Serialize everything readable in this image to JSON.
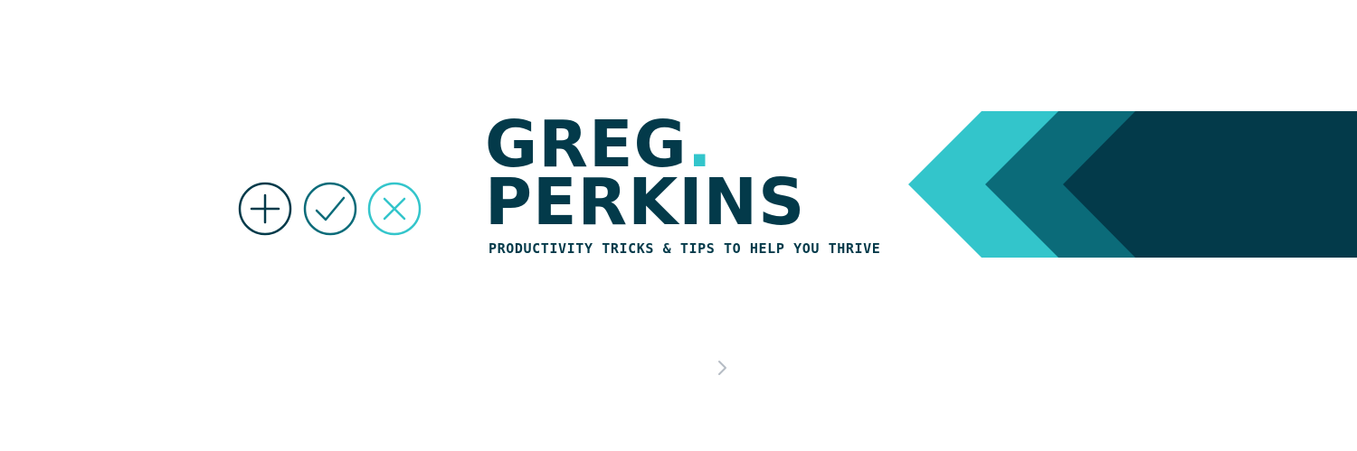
{
  "banner": {
    "name_line1": "GREG",
    "name_dot": ".",
    "name_line2": "PERKINS",
    "tagline": "PRODUCTIVITY TRICKS & TIPS TO HELP YOU THRIVE"
  },
  "icons": [
    {
      "name": "plus-circle-icon",
      "color": "#033a4a"
    },
    {
      "name": "check-circle-icon",
      "color": "#0b6b79"
    },
    {
      "name": "x-circle-icon",
      "color": "#33c5cb"
    }
  ],
  "colors": {
    "navy": "#033a4a",
    "teal": "#0b6b79",
    "aqua": "#33c5cb",
    "arrow_gray": "#b5bcc4"
  },
  "navigation": {
    "next_icon": "chevron-right-icon"
  }
}
